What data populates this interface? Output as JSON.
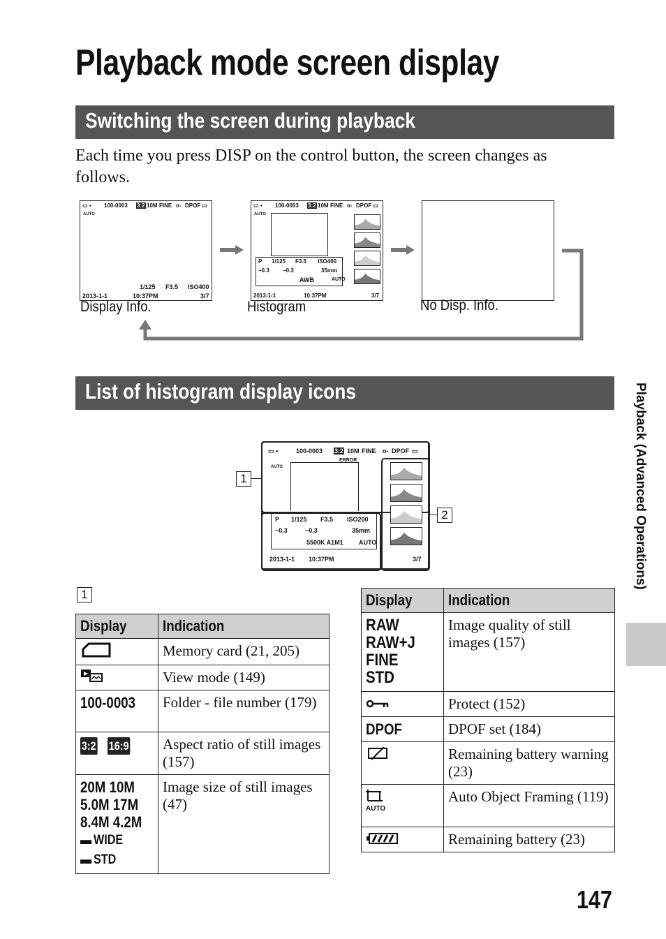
{
  "title": "Playback mode screen display",
  "section1": {
    "heading": "Switching the screen during playback",
    "body": "Each time you press DISP on the control button, the screen changes as follows."
  },
  "screens": {
    "top": {
      "folder": "100-0003",
      "aspect": "3:2",
      "size": "10M",
      "quality": "FINE",
      "dpof": "DPOF",
      "afr": "AUTO"
    },
    "info": {
      "shutter": "1/125",
      "aperture": "F3.5",
      "iso": "ISO400",
      "date": "2013-1-1",
      "time": "10:37PM",
      "count": "3/7"
    },
    "hist": {
      "mode": "P",
      "shutter": "1/125",
      "aperture": "F3.5",
      "iso": "ISO400",
      "ev": "−0.3",
      "flash": "−0.3",
      "focal": "35mm",
      "wb": "AWB",
      "dro": "AUTO",
      "date": "2013-1-1",
      "time": "10:37PM",
      "count": "3/7"
    },
    "labels": [
      "Display Info.",
      "Histogram",
      "No Disp. Info."
    ]
  },
  "section2": {
    "heading": "List of histogram display icons"
  },
  "diagram": {
    "folder": "100-0003",
    "aspect": "3:2",
    "size": "10M",
    "quality": "FINE",
    "dpof": "DPOF",
    "afr": "AUTO",
    "error": "ERROR",
    "mode": "P",
    "shutter": "1/125",
    "aperture": "F3.5",
    "iso": "ISO200",
    "ev": "−0.3",
    "flash": "−0.3",
    "focal": "35mm",
    "wb": "5500K A1M1",
    "dro": "AUTO",
    "date": "2013-1-1",
    "time": "10:37PM",
    "count": "3/7",
    "callouts": [
      "1",
      "2"
    ]
  },
  "table1": {
    "label": "1",
    "headers": [
      "Display",
      "Indication"
    ],
    "rows": [
      {
        "display": "memory-card-icon",
        "indication": "Memory card (21, 205)"
      },
      {
        "display": "view-mode-icon",
        "indication": "View mode (149)"
      },
      {
        "display": "100-0003",
        "indication": "Folder - file number (179)"
      },
      {
        "display": [
          "3:2",
          "16:9"
        ],
        "indication": "Aspect ratio of still images (157)"
      },
      {
        "display": [
          "20M 10M",
          "5.0M 17M",
          "8.4M 4.2M",
          "WIDE",
          "STD"
        ],
        "indication": "Image size of still images (47)"
      }
    ]
  },
  "table2": {
    "headers": [
      "Display",
      "Indication"
    ],
    "rows": [
      {
        "display": [
          "RAW",
          "RAW+J",
          "FINE",
          "STD"
        ],
        "indication": "Image quality of still images (157)"
      },
      {
        "display": "protect-key-icon",
        "indication": "Protect (152)"
      },
      {
        "display": "DPOF",
        "indication": "DPOF set (184)"
      },
      {
        "display": "battery-warning-icon",
        "indication": "Remaining battery warning (23)"
      },
      {
        "display": "AUTO",
        "indication": "Auto Object Framing (119)"
      },
      {
        "display": "battery-icon",
        "indication": "Remaining battery (23)"
      }
    ]
  },
  "side_tab": "Playback (Advanced Operations)",
  "page_number": "147"
}
